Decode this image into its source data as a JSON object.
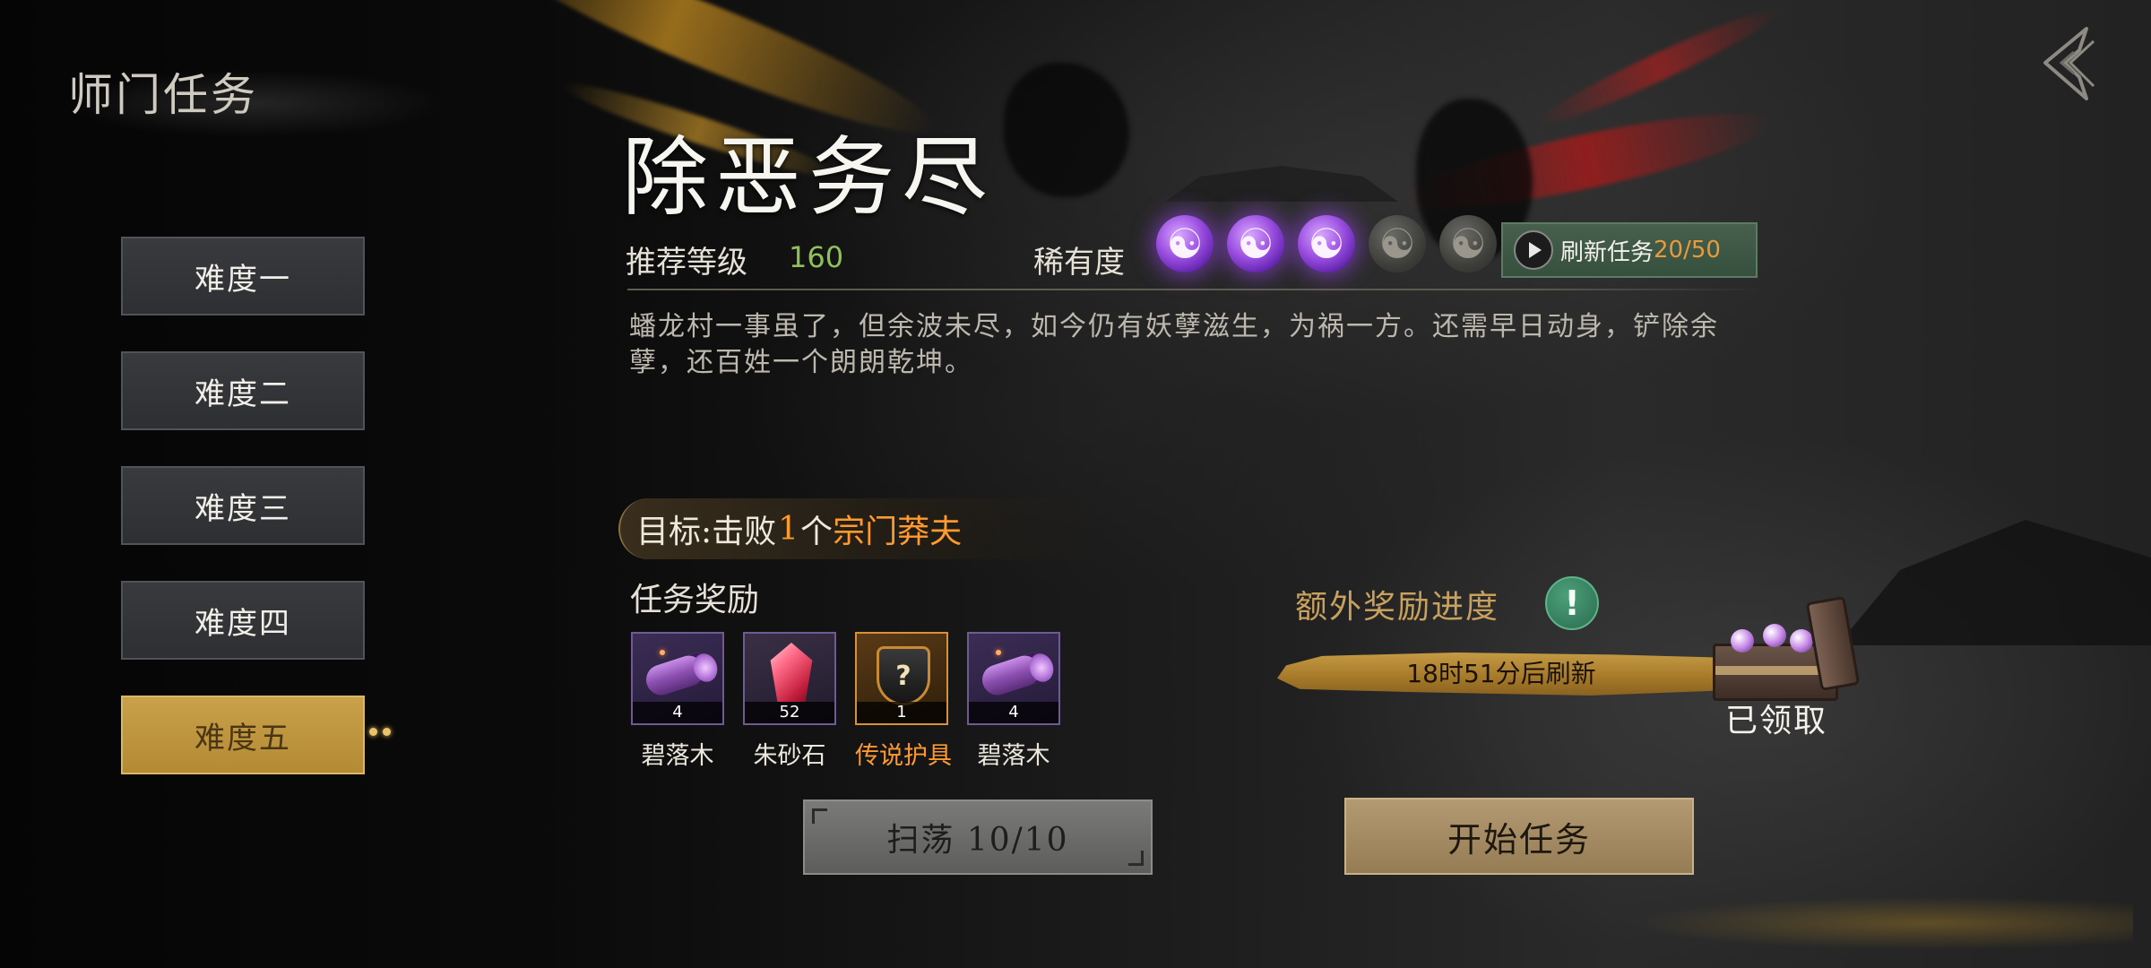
{
  "header": {
    "title": "师门任务",
    "back_icon": "back-arrow-icon"
  },
  "difficulty": {
    "items": [
      "难度一",
      "难度二",
      "难度三",
      "难度四",
      "难度五"
    ],
    "selected_index": 4
  },
  "mission": {
    "title": "除恶务尽",
    "recommended_level_label": "推荐等级",
    "recommended_level": "160",
    "rarity_label": "稀有度",
    "rarity": 3,
    "rarity_max": 5,
    "refresh": {
      "label": "刷新任务",
      "count": "20/50"
    },
    "description": "蟠龙村一事虽了，但余波未尽，如今仍有妖孽滋生，为祸一方。还需早日动身，铲除余孽，还百姓一个朗朗乾坤。",
    "objective": {
      "prefix": "目标:击败",
      "count": "1",
      "measure": "个",
      "target": "宗门莽夫"
    },
    "rewards_label": "任务奖励",
    "rewards": [
      {
        "name": "碧落木",
        "count": "4",
        "icon": "wood-icon",
        "rarity": "epic"
      },
      {
        "name": "朱砂石",
        "count": "52",
        "icon": "crystal-icon",
        "rarity": "epic"
      },
      {
        "name": "传说护具",
        "count": "1",
        "icon": "armor-mystery-icon",
        "rarity": "legendary"
      },
      {
        "name": "碧落木",
        "count": "4",
        "icon": "wood-icon",
        "rarity": "epic"
      }
    ]
  },
  "extra": {
    "label": "额外奖励进度",
    "info_icon": "exclamation-icon",
    "progress_text": "18时51分后刷新",
    "progress": 1.0,
    "chest_status": "已领取"
  },
  "actions": {
    "sweep_label": "扫荡 10/10",
    "start_label": "开始任务"
  },
  "colors": {
    "gold_accent": "#c9a14a",
    "orange_highlight": "#ff9a2e",
    "level_green": "#8fc05a",
    "rarity_purple": "#9b4fe0"
  }
}
